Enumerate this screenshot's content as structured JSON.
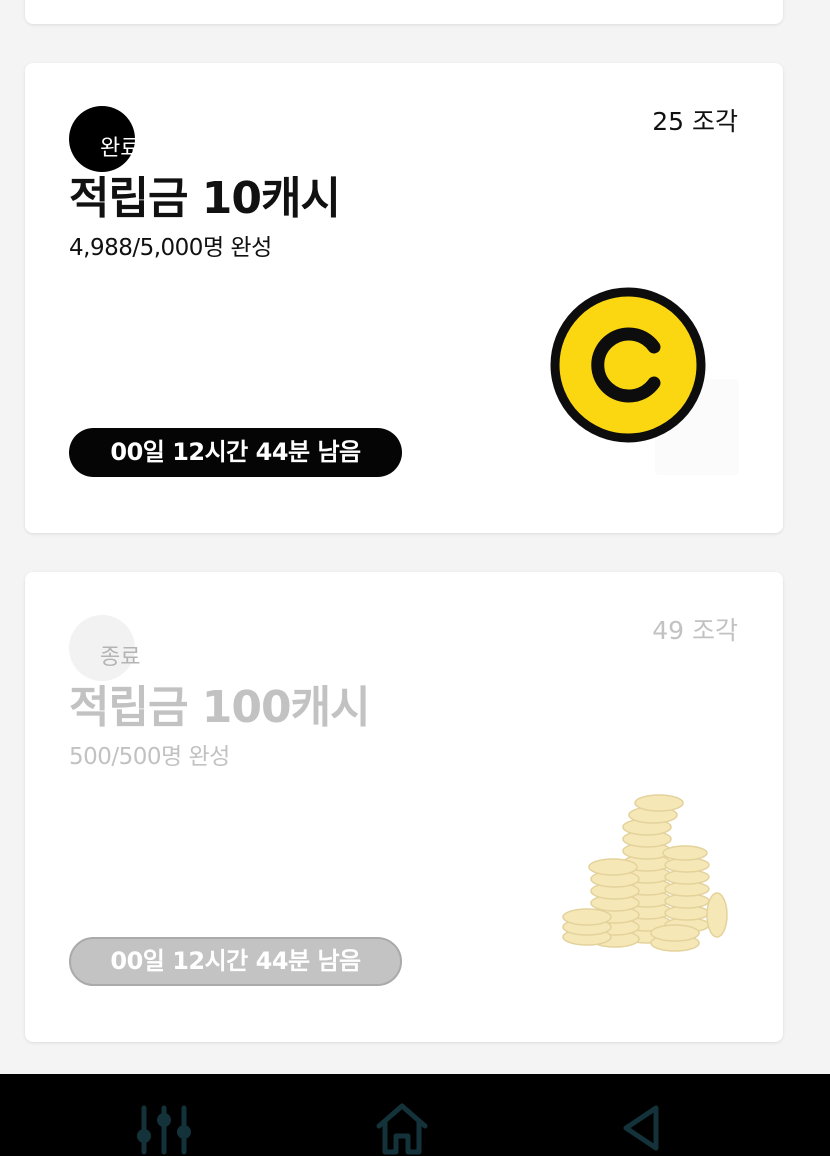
{
  "cards": [
    {
      "status": "완료",
      "pieces": "25 조각",
      "title": "적립금 10캐시",
      "progress": "4,988/5,000명 완성",
      "time_left": "00일 12시간 44분 남음",
      "image": "cash-coin-icon"
    },
    {
      "status": "종료",
      "pieces": "49 조각",
      "title": "적립금 100캐시",
      "progress": "500/500명 완성",
      "time_left": "00일 12시간 44분 남음",
      "image": "coin-stack-icon"
    }
  ],
  "navbar": {
    "recent": "recent-apps-icon",
    "home": "home-icon",
    "back": "back-icon"
  },
  "colors": {
    "coin_yellow": "#fbd712",
    "active_text": "#111111",
    "ended_text": "#c2c2c2",
    "navbar_icon": "#14323a"
  }
}
